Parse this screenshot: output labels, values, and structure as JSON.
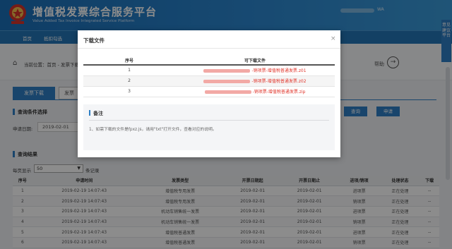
{
  "app": {
    "title": "增值税发票综合服务平台",
    "subtitle": "Value Added Tax Invoice Integrated Service Platform",
    "user_suffix": "WA",
    "side_tab": "意见建议平台"
  },
  "nav": {
    "items": [
      "首页",
      "抵扣勾选",
      "",
      "",
      "",
      "",
      ""
    ]
  },
  "breadcrumb": {
    "label": "当前位置：首页 - 发票下载",
    "help": "帮助",
    "help_icon": "→"
  },
  "toolbar": {
    "download_button": "发票下载",
    "second_button": "发票"
  },
  "query": {
    "title": "查询条件选择",
    "date_label": "申请日期:",
    "date_value": "2019-02-01",
    "query_button": "查询",
    "apply_button": "申请"
  },
  "results": {
    "title": "查询结果",
    "per_page_label": "每页显示",
    "per_page_value": "50",
    "per_page_unit": "条记录",
    "columns": [
      "序号",
      "申请时间",
      "发票类型",
      "开票日期起",
      "开票日期止",
      "进项/销项",
      "处理状态",
      "下载"
    ],
    "rows": [
      [
        "1",
        "2019-02-19 14:07:43",
        "增值税专用发票",
        "2019-02-01",
        "2019-02-01",
        "进项票",
        "正在处理",
        "--"
      ],
      [
        "2",
        "2019-02-19 14:07:43",
        "增值税专用发票",
        "2019-02-01",
        "2019-02-01",
        "销项票",
        "正在处理",
        "--"
      ],
      [
        "3",
        "2019-02-19 14:07:43",
        "机动车销售统一发票",
        "2019-02-01",
        "2019-02-01",
        "进项票",
        "正在处理",
        "--"
      ],
      [
        "4",
        "2019-02-19 14:07:43",
        "机动车销售统一发票",
        "2019-02-01",
        "2019-02-01",
        "销项票",
        "正在处理",
        "--"
      ],
      [
        "5",
        "2019-02-19 14:07:43",
        "增值税普通发票",
        "2019-02-01",
        "2019-02-01",
        "进项票",
        "正在处理",
        "--"
      ],
      [
        "6",
        "2019-02-19 14:07:43",
        "增值税普通发票",
        "2019-02-01",
        "2019-02-01",
        "销项票",
        "正在处理",
        "--"
      ]
    ]
  },
  "modal": {
    "title": "下载文件",
    "close_icon": "×",
    "columns": [
      "序号",
      "可下载文件"
    ],
    "files": [
      {
        "no": "1",
        "name": "-销项票-增值税普通发票.z01"
      },
      {
        "no": "2",
        "name": "-销项票-增值税普通发票.z02"
      },
      {
        "no": "3",
        "name": "-销项票-增值税普通发票.zip"
      }
    ],
    "note_title": "备注",
    "note_text": "1、如需下载的文件是fpxz.js，请用\"txt\"打开文件，查看对应的说明。"
  },
  "colors": {
    "brand": "#2475b6",
    "accent": "#2e7fc5",
    "link": "#e0352b"
  }
}
